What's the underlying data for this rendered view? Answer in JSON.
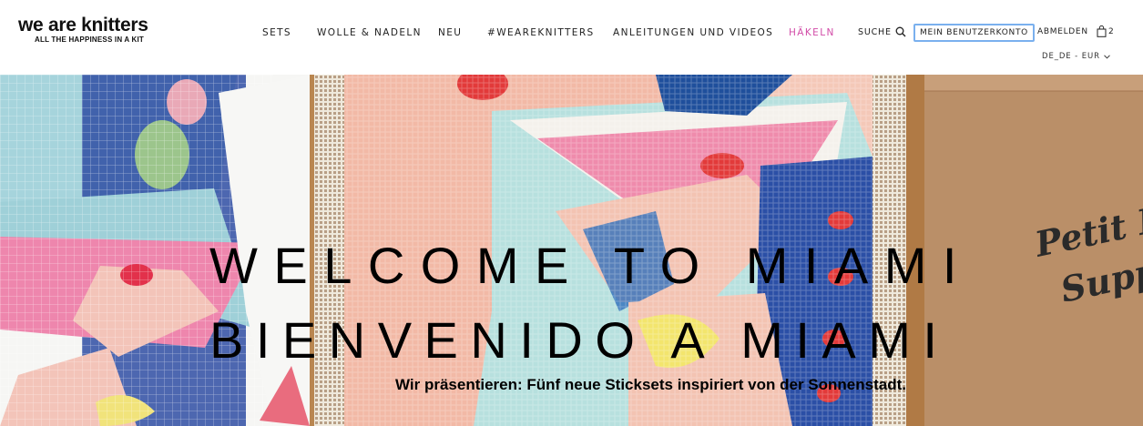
{
  "brand": {
    "name": "we are knitters",
    "tagline": "ALL THE HAPPINESS IN A KIT"
  },
  "nav": {
    "items": [
      {
        "label": "SETS"
      },
      {
        "label": "WOLLE & NADELN"
      },
      {
        "label": "NEU"
      },
      {
        "label": "#WEAREKNITTERS"
      },
      {
        "label": "ANLEITUNGEN UND VIDEOS"
      },
      {
        "label": "HÄKELN",
        "highlight": "#d24ca8"
      }
    ],
    "search_label": "SUCHE",
    "search_icon": "search-icon",
    "account_label": "MEIN BENUTZERKONTO",
    "logout_label": "ABMELDEN",
    "cart_icon": "shopping-bag-icon",
    "cart_count": "2",
    "locale_label": "DE_DE - EUR",
    "focus_color": "#7ab0ee"
  },
  "hero": {
    "line1": "WELCOME TO MIAMI",
    "line2": "BIENVENIDO A MIAMI",
    "subtitle": "Wir präsentieren: Fünf neue Sticksets inspiriert von der Sonnenstadt.",
    "package_text_line1": "Petit Poi",
    "package_text_line2": "Supp"
  }
}
